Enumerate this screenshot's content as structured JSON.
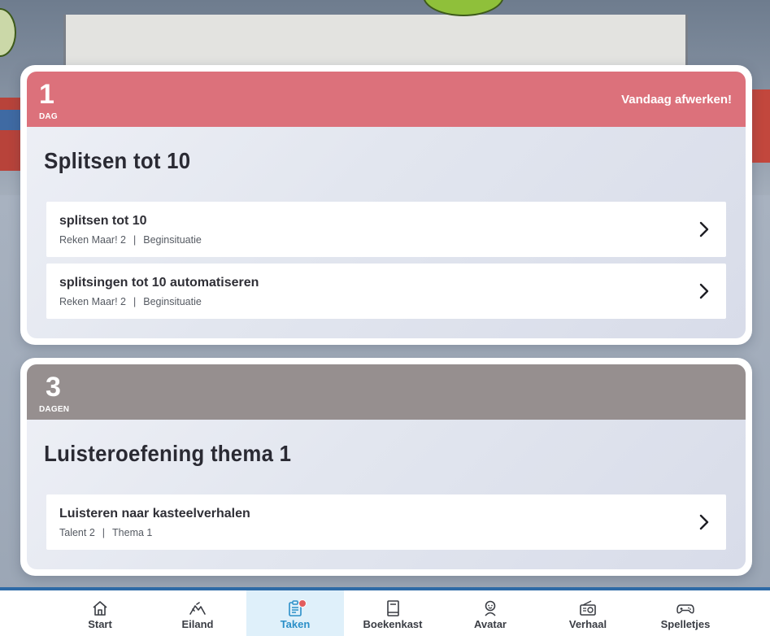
{
  "colors": {
    "urgent_header": "#dc717b",
    "normal_header": "#968f8f",
    "nav_accent": "#2e6aa6",
    "active_tab": "#2b8fc8"
  },
  "assignments": [
    {
      "days": "1",
      "days_unit": "DAG",
      "deadline_label": "Vandaag afwerken!",
      "title": "Splitsen tot 10",
      "tasks": [
        {
          "title": "splitsen tot 10",
          "method": "Reken Maar! 2",
          "separator": "|",
          "section": "Beginsituatie"
        },
        {
          "title": "splitsingen tot 10 automatiseren",
          "method": "Reken Maar! 2",
          "separator": "|",
          "section": "Beginsituatie"
        }
      ]
    },
    {
      "days": "3",
      "days_unit": "DAGEN",
      "deadline_label": "",
      "title": "Luisteroefening thema 1",
      "tasks": [
        {
          "title": "Luisteren naar kasteelverhalen",
          "method": "Talent 2",
          "separator": "|",
          "section": "Thema 1"
        }
      ]
    }
  ],
  "nav": {
    "items": [
      {
        "label": "Start",
        "icon": "home-icon"
      },
      {
        "label": "Eiland",
        "icon": "mountain-icon"
      },
      {
        "label": "Taken",
        "icon": "clipboard-icon",
        "active": true,
        "has_notification": true
      },
      {
        "label": "Boekenkast",
        "icon": "book-icon"
      },
      {
        "label": "Avatar",
        "icon": "avatar-icon"
      },
      {
        "label": "Verhaal",
        "icon": "radio-icon"
      },
      {
        "label": "Spelletjes",
        "icon": "gamepad-icon"
      }
    ]
  }
}
